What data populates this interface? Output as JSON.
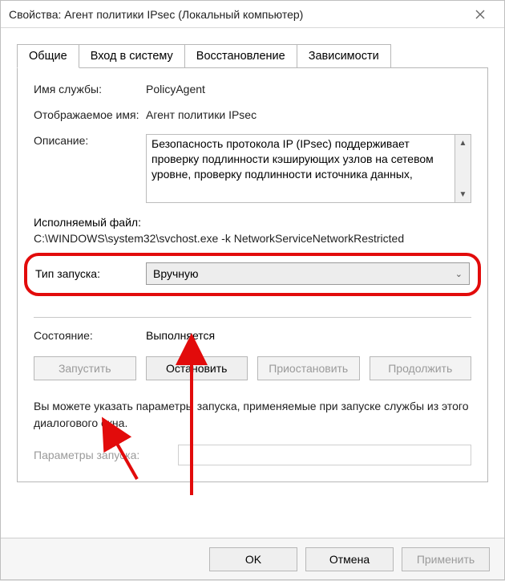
{
  "window": {
    "title": "Свойства: Агент политики IPsec (Локальный компьютер)"
  },
  "tabs": {
    "general": "Общие",
    "logon": "Вход в систему",
    "recovery": "Восстановление",
    "dependencies": "Зависимости"
  },
  "fields": {
    "service_name_label": "Имя службы:",
    "service_name_value": "PolicyAgent",
    "display_name_label": "Отображаемое имя:",
    "display_name_value": "Агент политики IPsec",
    "description_label": "Описание:",
    "description_value": "Безопасность протокола IP (IPsec) поддерживает проверку подлинности кэширующих узлов на сетевом уровне, проверку подлинности источника данных,",
    "executable_label": "Исполняемый файл:",
    "executable_value": "C:\\WINDOWS\\system32\\svchost.exe -k NetworkServiceNetworkRestricted",
    "startup_type_label": "Тип запуска:",
    "startup_type_value": "Вручную",
    "status_label": "Состояние:",
    "status_value": "Выполняется",
    "hint": "Вы можете указать параметры запуска, применяемые при запуске службы из этого диалогового окна.",
    "params_label": "Параметры запуска:",
    "params_value": ""
  },
  "buttons": {
    "start": "Запустить",
    "stop": "Остановить",
    "pause": "Приостановить",
    "resume": "Продолжить",
    "ok": "OK",
    "cancel": "Отмена",
    "apply": "Применить"
  },
  "colors": {
    "highlight": "#e20b0b"
  }
}
